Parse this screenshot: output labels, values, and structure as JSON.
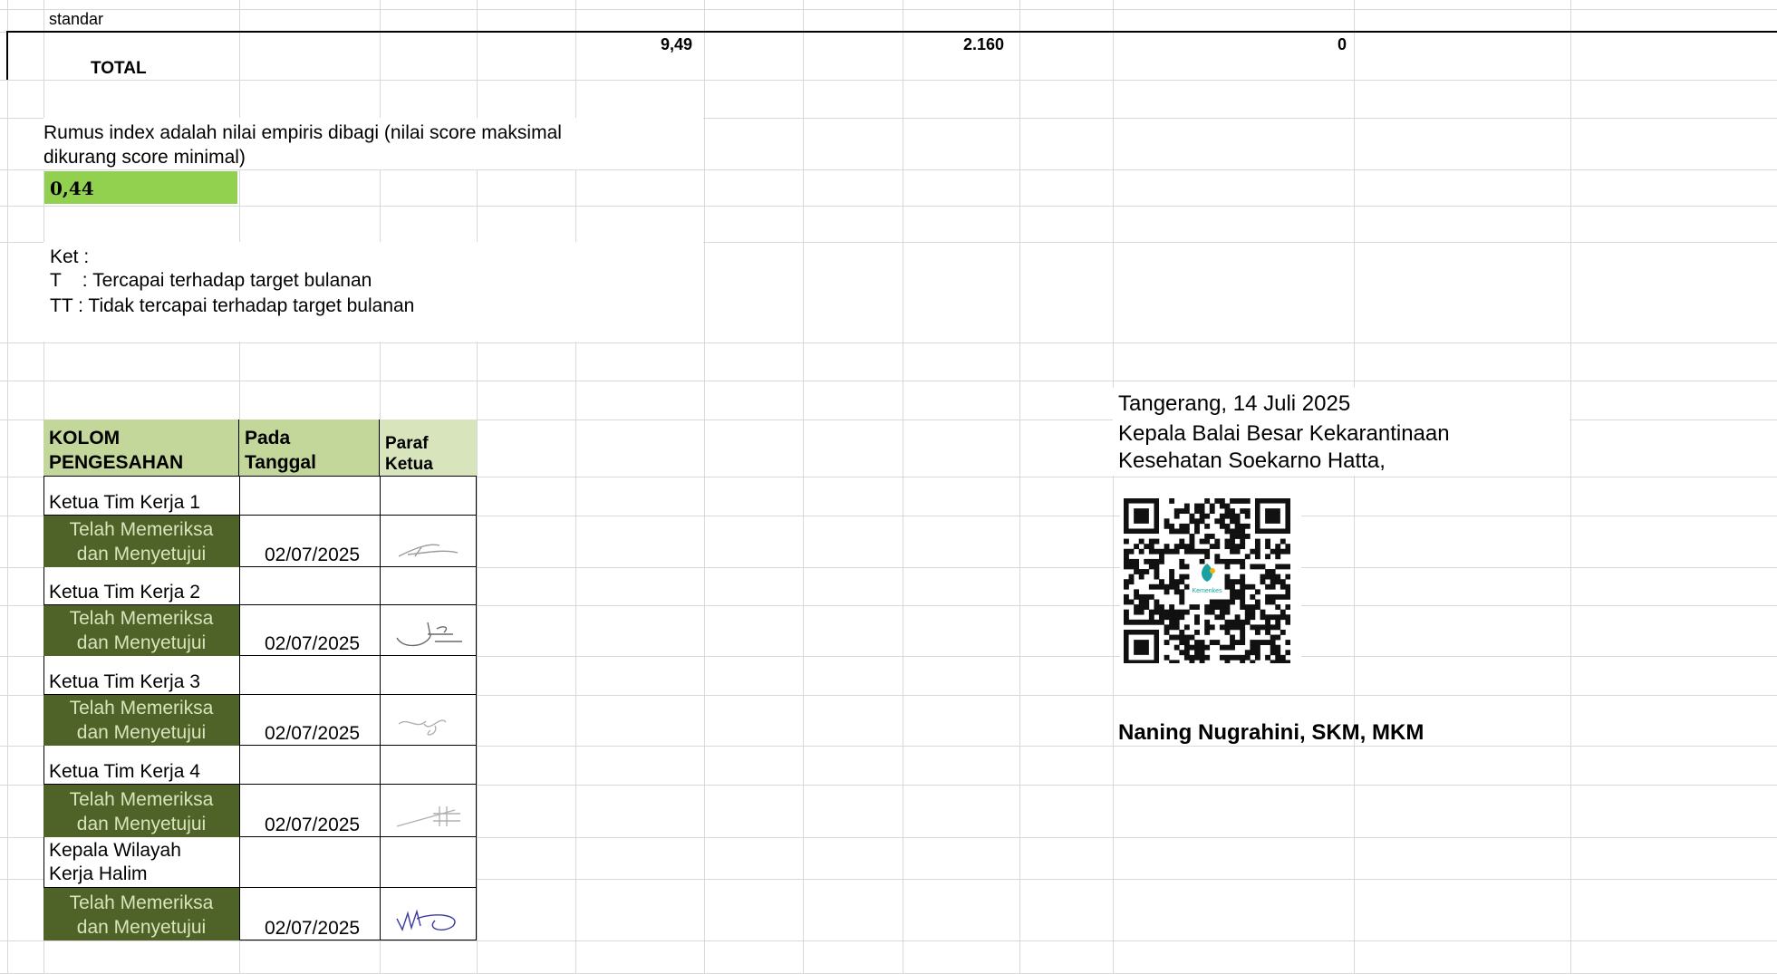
{
  "top": {
    "label_standar": "standar",
    "total_label": "TOTAL",
    "total_values": [
      "9,49",
      "2.160",
      "0"
    ]
  },
  "index": {
    "formula_line1": "Rumus index adalah nilai empiris dibagi (nilai score maksimal",
    "formula_line2": "dikurang score minimal)",
    "value": "0,44",
    "value_color": "#92d050"
  },
  "ket": {
    "title": "Ket :",
    "line_t": "T    : Tercapai terhadap target bulanan",
    "line_tt": "TT : Tidak tercapai terhadap target bulanan"
  },
  "approval": {
    "header": {
      "col1_line1": "KOLOM",
      "col1_line2": "PENGESAHAN",
      "col2_line1": "Pada",
      "col2_line2": "Tanggal",
      "col3_line1": "Paraf",
      "col3_line2": "Ketua"
    },
    "header_color": "#c4d79b",
    "status_color": "#4f6228",
    "status_text_color": "#d8e4bc",
    "rows": [
      {
        "role_line1": "Ketua Tim Kerja 1",
        "role_line2": "",
        "status_line1": "Telah Memeriksa",
        "status_line2": "dan Menyetujui",
        "date": "02/07/2025"
      },
      {
        "role_line1": "Ketua Tim Kerja 2",
        "role_line2": "",
        "status_line1": "Telah Memeriksa",
        "status_line2": "dan Menyetujui",
        "date": "02/07/2025"
      },
      {
        "role_line1": "Ketua Tim Kerja 3",
        "role_line2": "",
        "status_line1": "Telah Memeriksa",
        "status_line2": "dan Menyetujui",
        "date": "02/07/2025"
      },
      {
        "role_line1": "Ketua Tim Kerja 4",
        "role_line2": "",
        "status_line1": "Telah Memeriksa",
        "status_line2": "dan Menyetujui",
        "date": "02/07/2025"
      },
      {
        "role_line1": "Kepala Wilayah",
        "role_line2": "Kerja Halim",
        "status_line1": "Telah Memeriksa",
        "status_line2": "dan Menyetujui",
        "date": "02/07/2025"
      }
    ]
  },
  "signature": {
    "place_date": "Tangerang, 14 Juli 2025",
    "title_line1": "Kepala Balai Besar Kekarantinaan",
    "title_line2": "Kesehatan Soekarno Hatta,",
    "qr_logo_text": "Kemenkes",
    "name": "Naning Nugrahini, SKM, MKM"
  }
}
